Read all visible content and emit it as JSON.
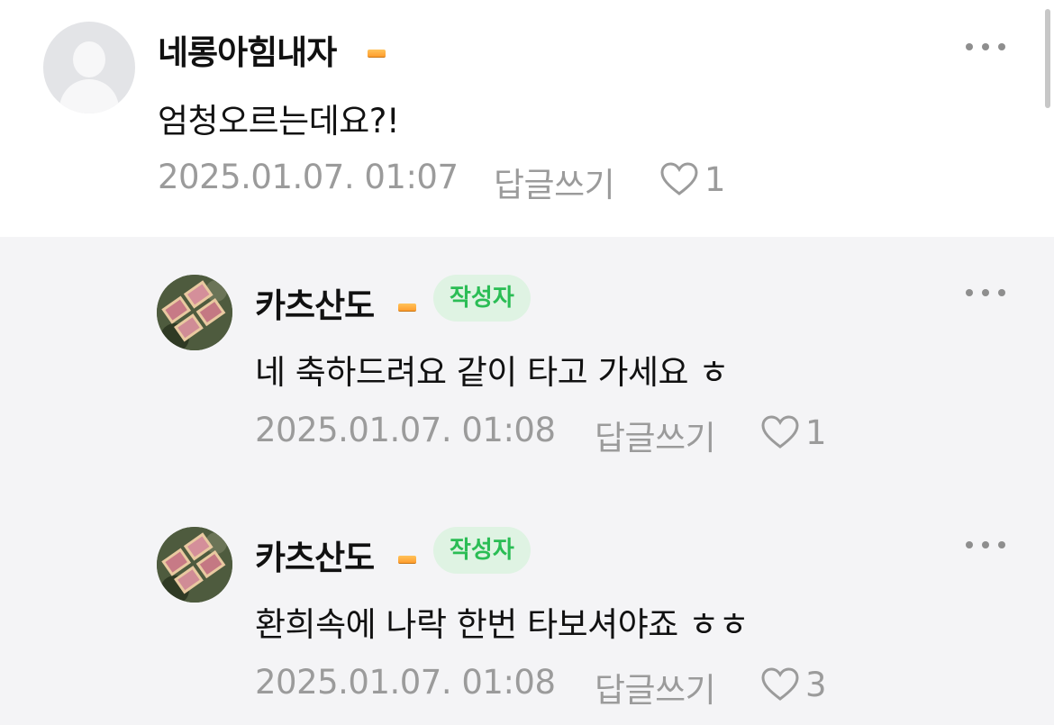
{
  "comments": [
    {
      "nickname": "네롱아힘내자",
      "text": "엄청오르는데요?!",
      "date": "2025.01.07. 01:07",
      "reply_label": "답글쓰기",
      "likes": "1"
    }
  ],
  "replies": [
    {
      "nickname": "카츠산도",
      "author_badge": "작성자",
      "text": "네 축하드려요 같이 타고 가세요 ㅎ",
      "date": "2025.01.07. 01:08",
      "reply_label": "답글쓰기",
      "likes": "1"
    },
    {
      "nickname": "카츠산도",
      "author_badge": "작성자",
      "text": "환희속에 나락 한번 타보셔야죠 ㅎㅎ",
      "date": "2025.01.07. 01:08",
      "reply_label": "답글쓰기",
      "likes": "3"
    }
  ],
  "icons": {
    "more": "more-dots-icon",
    "like": "heart-outline-icon",
    "level": "level-badge-icon"
  },
  "colors": {
    "author_badge_bg": "#dff3e3",
    "author_badge_text": "#2bbd55",
    "meta_text": "#9b9b9b",
    "reply_background": "#f4f4f6"
  }
}
